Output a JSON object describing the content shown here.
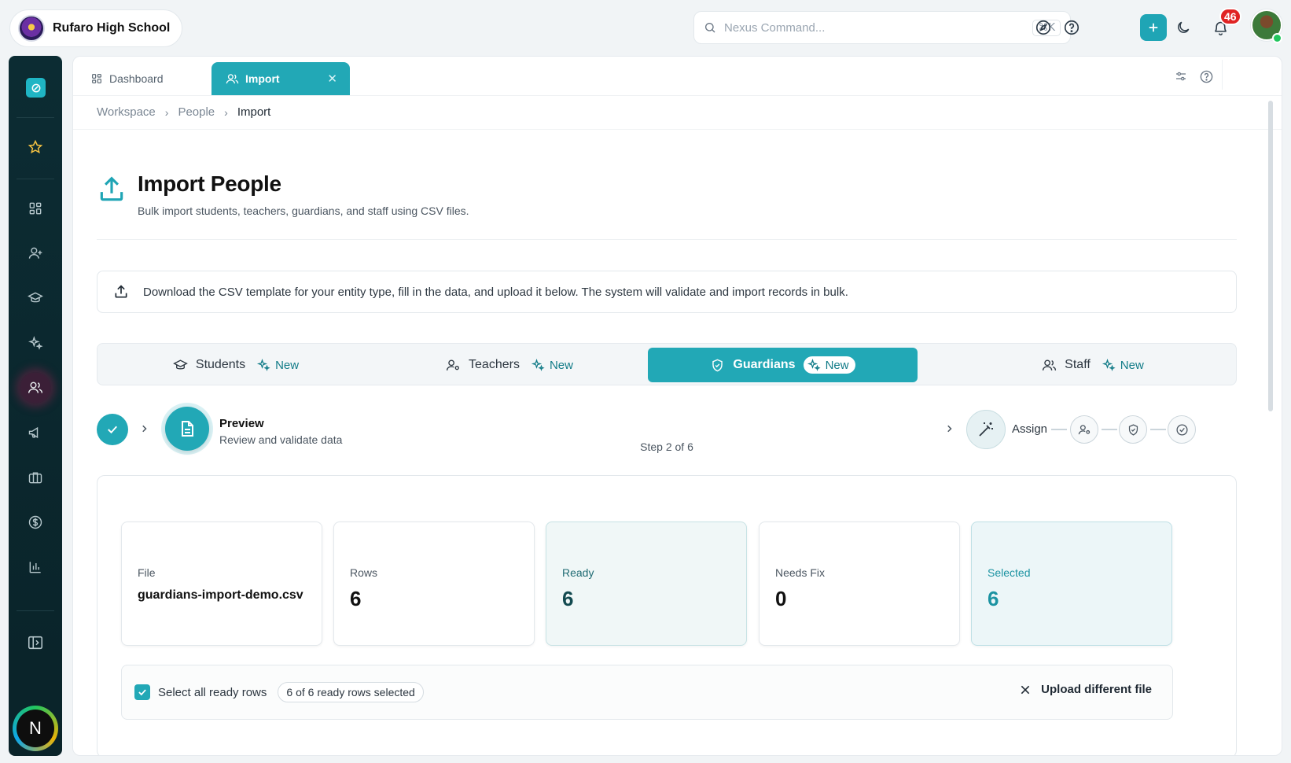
{
  "header": {
    "school_name": "Rufaro High School",
    "search_placeholder": "Nexus Command...",
    "search_shortcut": "⌘K",
    "notification_count": "46"
  },
  "tabs": [
    {
      "label": "Dashboard"
    },
    {
      "label": "Import"
    }
  ],
  "breadcrumb": [
    "Workspace",
    "People",
    "Import"
  ],
  "page": {
    "title": "Import People",
    "subtitle": "Bulk import students, teachers, guardians, and staff using CSV files."
  },
  "info_banner": "Download the CSV template for your entity type, fill in the data, and upload it below. The system will validate and import records in bulk.",
  "entity_tabs": [
    {
      "label": "Students",
      "badge": "New"
    },
    {
      "label": "Teachers",
      "badge": "New"
    },
    {
      "label": "Guardians",
      "badge": "New"
    },
    {
      "label": "Staff",
      "badge": "New"
    }
  ],
  "stepper": {
    "current_title": "Preview",
    "current_desc": "Review and validate data",
    "next_label": "Assign",
    "counter": "Step 2 of 6"
  },
  "stats": {
    "file_label": "File",
    "file_value": "guardians-import-demo.csv",
    "rows_label": "Rows",
    "rows_value": "6",
    "ready_label": "Ready",
    "ready_value": "6",
    "needs_fix_label": "Needs Fix",
    "needs_fix_value": "0",
    "selected_label": "Selected",
    "selected_value": "6"
  },
  "selection": {
    "select_all_label": "Select all ready rows",
    "summary": "6 of 6 ready rows selected",
    "upload_label": "Upload different file"
  },
  "colors": {
    "accent": "#22a8b6",
    "sidebar": "#0c2c33",
    "badge": "#e02424"
  }
}
